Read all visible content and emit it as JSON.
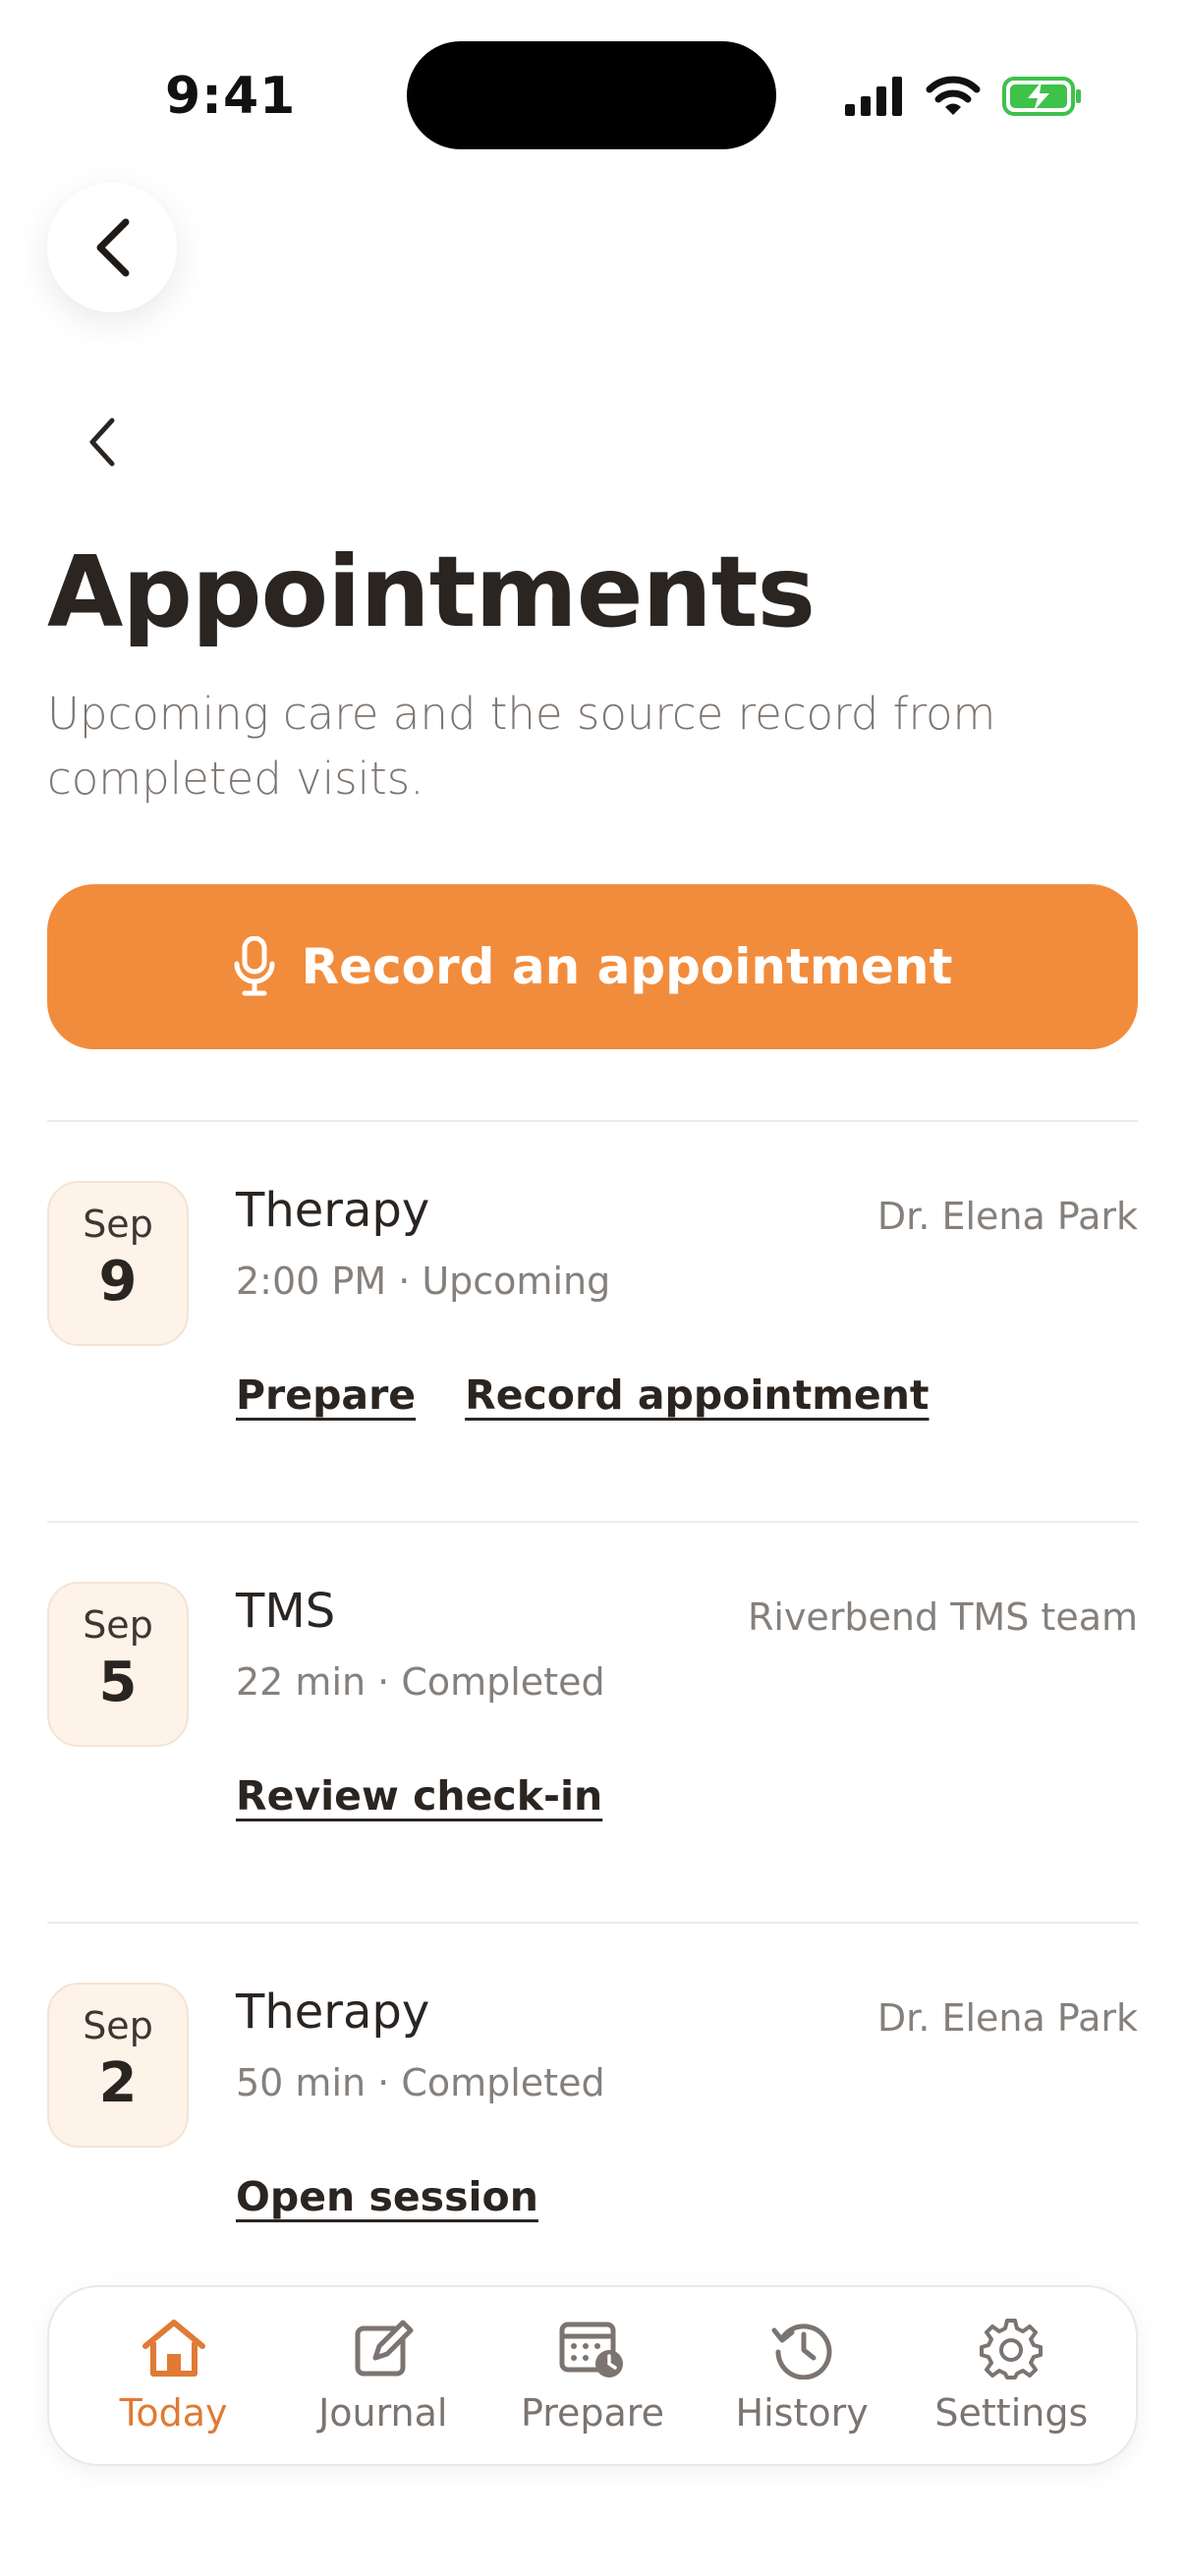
{
  "status": {
    "time": "9:41"
  },
  "header": {
    "title": "Appointments",
    "subtitle": "Upcoming care and the source record from completed visits."
  },
  "primary_action": {
    "label": "Record an appointment",
    "icon": "microphone-icon"
  },
  "appointments": [
    {
      "month": "Sep",
      "day": "9",
      "type": "Therapy",
      "provider": "Dr. Elena Park",
      "meta": "2:00 PM · Upcoming",
      "actions": [
        "Prepare",
        "Record appointment"
      ]
    },
    {
      "month": "Sep",
      "day": "5",
      "type": "TMS",
      "provider": "Riverbend TMS team",
      "meta": "22 min · Completed",
      "actions": [
        "Review check-in"
      ]
    },
    {
      "month": "Sep",
      "day": "2",
      "type": "Therapy",
      "provider": "Dr. Elena Park",
      "meta": "50 min · Completed",
      "actions": [
        "Open session"
      ]
    }
  ],
  "tabs": [
    {
      "label": "Today",
      "icon": "home-icon",
      "active": true
    },
    {
      "label": "Journal",
      "icon": "journal-edit-icon",
      "active": false
    },
    {
      "label": "Prepare",
      "icon": "calendar-clock-icon",
      "active": false
    },
    {
      "label": "History",
      "icon": "history-icon",
      "active": false
    },
    {
      "label": "Settings",
      "icon": "gear-icon",
      "active": false
    }
  ],
  "colors": {
    "accent": "#f28c3d",
    "accent_text": "#e07a34",
    "tile_bg": "#fdf3e9",
    "battery": "#3ec24a"
  }
}
